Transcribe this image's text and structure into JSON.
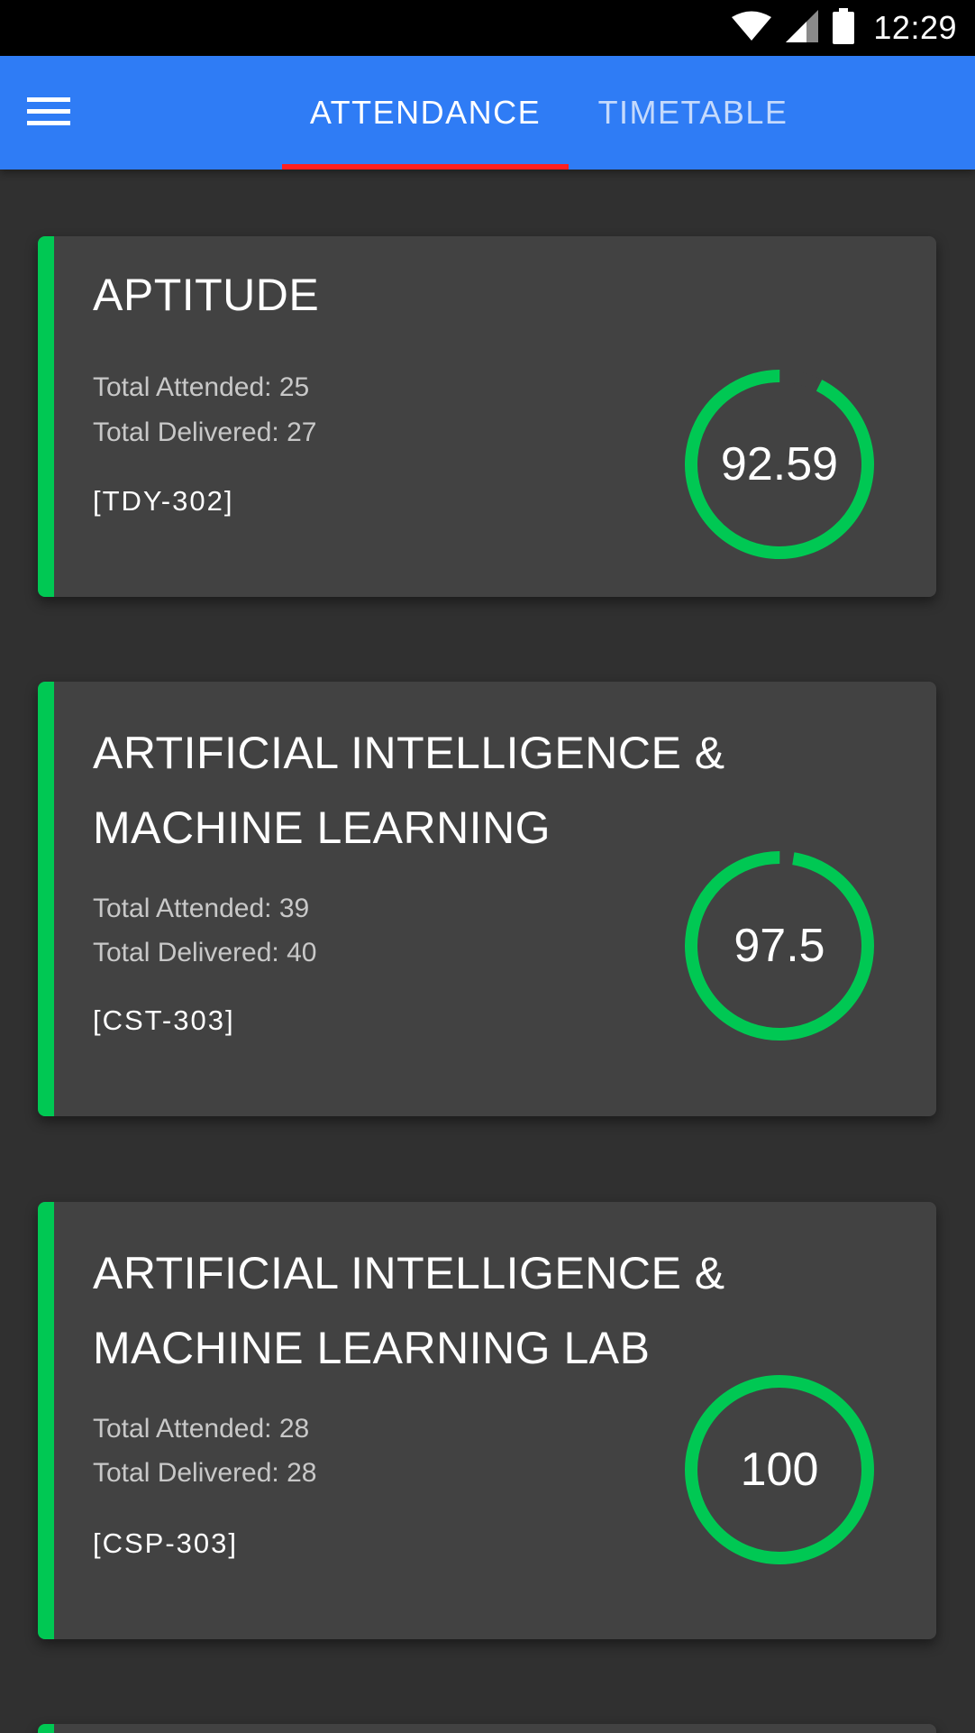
{
  "status_bar": {
    "time": "12:29",
    "icons": [
      "wifi-icon",
      "signal-icon",
      "battery-icon"
    ]
  },
  "app_bar": {
    "menu_icon": "hamburger-menu-icon",
    "tabs": [
      {
        "label": "ATTENDANCE",
        "active": true
      },
      {
        "label": "TIMETABLE",
        "active": false
      }
    ]
  },
  "colors": {
    "app_bar": "#2f7cf5",
    "tab_indicator": "#ff1f1f",
    "accent_green": "#00c853",
    "card_bg": "#424242",
    "page_bg": "#303030"
  },
  "courses": [
    {
      "title": "APTITUDE",
      "attended_text": "Total Attended: 25",
      "delivered_text": "Total Delivered: 27",
      "code": "[TDY-302]",
      "percentage": "92.59",
      "percentage_value": 92.59
    },
    {
      "title": "ARTIFICIAL INTELLIGENCE & MACHINE LEARNING",
      "attended_text": "Total Attended: 39",
      "delivered_text": "Total Delivered: 40",
      "code": "[CST-303]",
      "percentage": "97.5",
      "percentage_value": 97.5
    },
    {
      "title": "ARTIFICIAL INTELLIGENCE & MACHINE LEARNING LAB",
      "attended_text": "Total Attended: 28",
      "delivered_text": "Total Delivered: 28",
      "code": "[CSP-303]",
      "percentage": "100",
      "percentage_value": 100
    }
  ]
}
